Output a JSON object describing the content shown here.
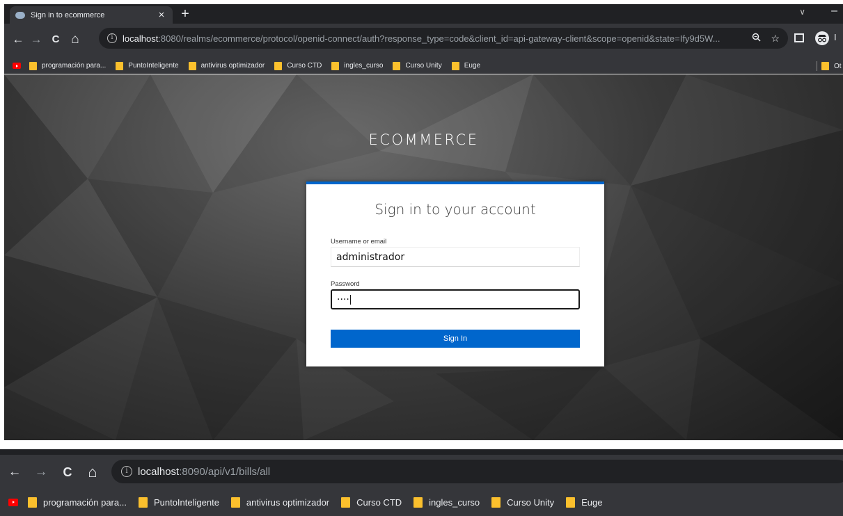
{
  "browser": {
    "tab": {
      "title": "Sign in to ecommerce",
      "close": "×"
    },
    "new_tab": "+",
    "window": {
      "chevron": "∨",
      "minimize": "–"
    },
    "nav": {
      "back": "←",
      "forward": "→",
      "reload": "C",
      "home": "⌂"
    },
    "info_glyph": "i",
    "address": {
      "host": "localhost",
      "rest": ":8080/realms/ecommerce/protocol/openid-connect/auth?response_type=code&client_id=api-gateway-client&scope=openid&state=Ify9d5W..."
    },
    "profile_letter": "I",
    "bookmarks": [
      "programación para...",
      "PuntoInteligente",
      "antivirus optimizador",
      "Curso CTD",
      "ingles_curso",
      "Curso Unity",
      "Euge"
    ],
    "other_bookmarks": "Ot"
  },
  "login": {
    "realm": "ECOMMERCE",
    "title": "Sign in to your account",
    "username_label": "Username or email",
    "username_value": "administrador",
    "password_label": "Password",
    "password_mask": "····",
    "submit": "Sign In"
  },
  "browser2": {
    "address": {
      "host": "localhost",
      "rest": ":8090/api/v1/bills/all"
    },
    "bookmarks": [
      "programación para...",
      "PuntoInteligente",
      "antivirus optimizador",
      "Curso CTD",
      "ingles_curso",
      "Curso Unity",
      "Euge"
    ]
  },
  "colors": {
    "brand_blue": "#0066cc",
    "chrome_dark": "#35363a",
    "folder_yellow": "#fbc02d"
  }
}
